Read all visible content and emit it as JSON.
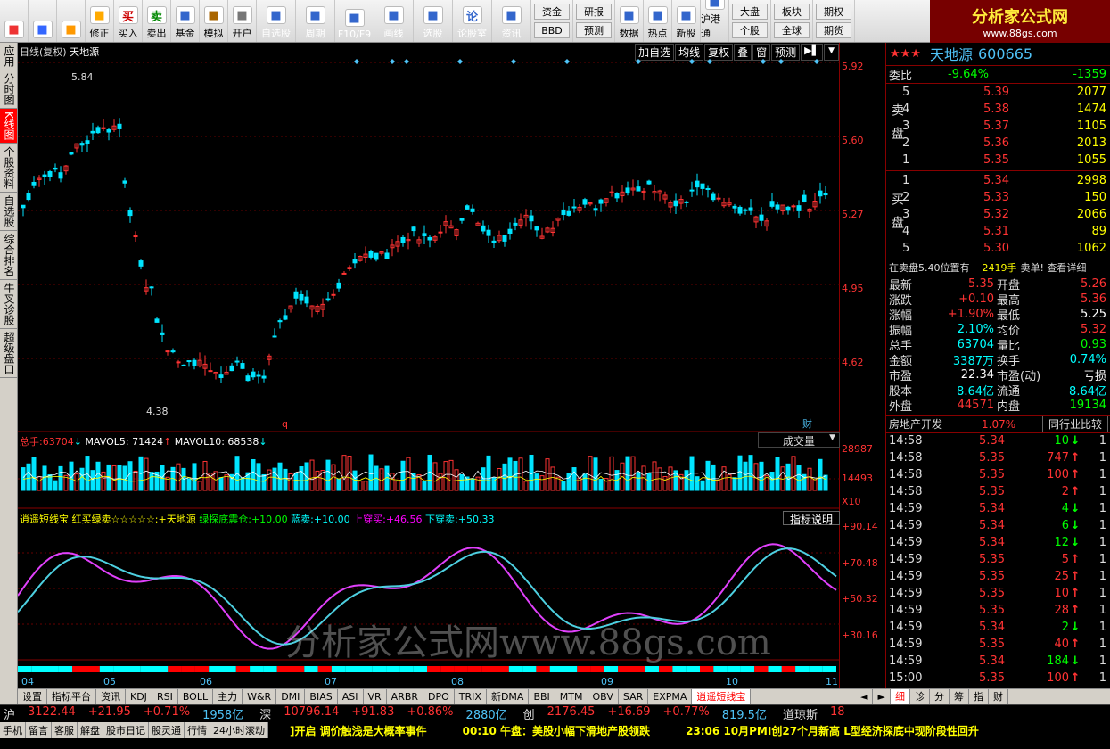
{
  "toolbar": {
    "buttons": [
      {
        "icon": "grid-icon",
        "label": ""
      },
      {
        "icon": "back-arrow-icon",
        "label": ""
      },
      {
        "icon": "up-down-icon",
        "label": ""
      },
      {
        "icon": "modify-icon",
        "label": "修正"
      },
      {
        "icon": "buy-icon",
        "label": "买入",
        "glyph": "买"
      },
      {
        "icon": "sell-icon",
        "label": "卖出",
        "glyph": "卖"
      },
      {
        "icon": "fund-icon",
        "label": "基金"
      },
      {
        "icon": "simulate-icon",
        "label": "模拟"
      },
      {
        "icon": "lock-icon",
        "label": "开户"
      },
      {
        "icon": "watchlist-icon",
        "label": "自选股"
      },
      {
        "icon": "period-icon",
        "label": "周期"
      },
      {
        "icon": "f10-icon",
        "label": "F10/F9"
      },
      {
        "icon": "draw-icon",
        "label": "画线"
      },
      {
        "icon": "select-stock-icon",
        "label": "选股"
      },
      {
        "icon": "forum-icon",
        "label": "论股室",
        "glyph": "论"
      },
      {
        "icon": "news-icon",
        "label": "资讯"
      }
    ],
    "group1": [
      "资金",
      "BBD"
    ],
    "group2": [
      "研报",
      "预测"
    ],
    "buttons2": [
      {
        "icon": "pe-icon",
        "label": "数据"
      },
      {
        "icon": "hot-icon",
        "label": "热点"
      },
      {
        "icon": "ipo-icon",
        "label": "新股"
      },
      {
        "icon": "hk-connect-icon",
        "label": "沪港通"
      }
    ],
    "group3": [
      "大盘",
      "个股"
    ],
    "group4": [
      "板块",
      "全球"
    ],
    "group5": [
      "期权",
      "期货"
    ]
  },
  "logo": {
    "title": "分析家公式网",
    "url": "www.88gs.com"
  },
  "left_tabs": [
    {
      "label": "应用",
      "active": false
    },
    {
      "label": "分时图",
      "active": false
    },
    {
      "label": "K线图",
      "active": true
    },
    {
      "label": "个股资料",
      "active": false
    },
    {
      "label": "自选股",
      "active": false
    },
    {
      "label": "综合排名",
      "active": false
    },
    {
      "label": "牛叉诊股",
      "active": false
    },
    {
      "label": "超级盘口",
      "active": false
    }
  ],
  "chart_header": {
    "period": "日线(复权)",
    "name": "天地源"
  },
  "chart_buttons": [
    "加自选",
    "均线",
    "复权",
    "叠",
    "窗",
    "预测"
  ],
  "price_axis": [
    "5.92",
    "5.60",
    "5.27",
    "4.95",
    "4.62"
  ],
  "annotations": {
    "high": "5.84",
    "low": "4.38",
    "q_mark": "q",
    "cai_mark": "财"
  },
  "volume_legend": {
    "label": "总手:",
    "value": "63704",
    "arrow1": "↓",
    "ma5": "MAVOL5: 71424",
    "arrow2": "↑",
    "ma10": "MAVOL10: 68538",
    "arrow3": "↓"
  },
  "volume_axis": [
    "28987",
    "14493",
    "X10"
  ],
  "volume_select": "成交量",
  "indicator_legend": {
    "name": "逍遥短线宝",
    "text1": "红买绿卖☆☆☆☆☆:",
    "text2": "+天地源",
    "t3": "绿探底震仓:",
    "v3": "+10.00",
    "t4": "蓝卖:",
    "v4": "+10.00",
    "t5": "上穿买:",
    "v5": "+46.56",
    "t6": "下穿卖:",
    "v6": "+50.33"
  },
  "indicator_button": "指标说明",
  "indicator_axis": [
    "+90.14",
    "+70.48",
    "+50.32",
    "+30.16"
  ],
  "x_axis": [
    "04",
    "05",
    "06",
    "07",
    "08",
    "09",
    "10",
    "11"
  ],
  "watermark": "分析家公式网www.88gs.com",
  "quote": {
    "stars": "★★★",
    "name": "天地源",
    "code": "600665",
    "weibi_label": "委比",
    "weibi_pct": "-9.64%",
    "weibi_val": "-1359",
    "sell_label": "卖盘",
    "buy_label": "买盘",
    "sell": [
      {
        "lvl": "5",
        "price": "5.39",
        "vol": "2077"
      },
      {
        "lvl": "4",
        "price": "5.38",
        "vol": "1474"
      },
      {
        "lvl": "3",
        "price": "5.37",
        "vol": "1105"
      },
      {
        "lvl": "2",
        "price": "5.36",
        "vol": "2013"
      },
      {
        "lvl": "1",
        "price": "5.35",
        "vol": "1055"
      }
    ],
    "buy": [
      {
        "lvl": "1",
        "price": "5.34",
        "vol": "2998"
      },
      {
        "lvl": "2",
        "price": "5.33",
        "vol": "150"
      },
      {
        "lvl": "3",
        "price": "5.32",
        "vol": "2066"
      },
      {
        "lvl": "4",
        "price": "5.31",
        "vol": "89"
      },
      {
        "lvl": "5",
        "price": "5.30",
        "vol": "1062"
      }
    ],
    "bigorder": {
      "text": "在卖盘5.40位置有",
      "vol": "2419手",
      "tail": "卖单! 查看详细"
    },
    "stats": [
      [
        "最新",
        "5.35",
        "r",
        "开盘",
        "5.26",
        "r"
      ],
      [
        "涨跌",
        "+0.10",
        "r",
        "最高",
        "5.36",
        "r"
      ],
      [
        "涨幅",
        "+1.90%",
        "r",
        "最低",
        "5.25",
        "w"
      ],
      [
        "振幅",
        "2.10%",
        "c",
        "均价",
        "5.32",
        "r"
      ],
      [
        "总手",
        "63704",
        "c",
        "量比",
        "0.93",
        "g"
      ],
      [
        "金额",
        "3387万",
        "c",
        "换手",
        "0.74%",
        "c"
      ],
      [
        "市盈",
        "22.34",
        "w",
        "市盈(动)",
        "亏损",
        "w"
      ],
      [
        "股本",
        "8.64亿",
        "c",
        "流通",
        "8.64亿",
        "c"
      ],
      [
        "外盘",
        "44571",
        "r",
        "内盘",
        "19134",
        "g"
      ]
    ],
    "sector": {
      "name": "房地产开发",
      "pct": "1.07%",
      "btn": "同行业比较"
    },
    "ticks": [
      [
        "14:58",
        "5.34",
        "10",
        "↓",
        "g",
        "1"
      ],
      [
        "14:58",
        "5.35",
        "747",
        "↑",
        "r",
        "1"
      ],
      [
        "14:58",
        "5.35",
        "100",
        "↑",
        "r",
        "1"
      ],
      [
        "14:58",
        "5.35",
        "2",
        "↑",
        "r",
        "1"
      ],
      [
        "14:59",
        "5.34",
        "4",
        "↓",
        "g",
        "1"
      ],
      [
        "14:59",
        "5.34",
        "6",
        "↓",
        "g",
        "1"
      ],
      [
        "14:59",
        "5.34",
        "12",
        "↓",
        "g",
        "1"
      ],
      [
        "14:59",
        "5.35",
        "5",
        "↑",
        "r",
        "1"
      ],
      [
        "14:59",
        "5.35",
        "25",
        "↑",
        "r",
        "1"
      ],
      [
        "14:59",
        "5.35",
        "10",
        "↑",
        "r",
        "1"
      ],
      [
        "14:59",
        "5.35",
        "28",
        "↑",
        "r",
        "1"
      ],
      [
        "14:59",
        "5.34",
        "2",
        "↓",
        "g",
        "1"
      ],
      [
        "14:59",
        "5.35",
        "40",
        "↑",
        "r",
        "1"
      ],
      [
        "14:59",
        "5.34",
        "184",
        "↓",
        "g",
        "1"
      ],
      [
        "15:00",
        "5.35",
        "100",
        "↑",
        "r",
        "1"
      ]
    ]
  },
  "bottom_tabs": [
    "设置",
    "指标平台",
    "资讯",
    "KDJ",
    "RSI",
    "BOLL",
    "主力",
    "W&R",
    "DMI",
    "BIAS",
    "ASI",
    "VR",
    "ARBR",
    "DPO",
    "TRIX",
    "新DMA",
    "BBI",
    "MTM",
    "OBV",
    "SAR",
    "EXPMA",
    "逍遥短线宝"
  ],
  "right_tabs": [
    "细",
    "诊",
    "分",
    "筹",
    "指",
    "财"
  ],
  "indexes": [
    {
      "name": "沪",
      "val": "3122.44",
      "chg": "+21.95",
      "pct": "+0.71%",
      "amt": "1958亿"
    },
    {
      "name": "深",
      "val": "10796.14",
      "chg": "+91.83",
      "pct": "+0.86%",
      "amt": "2880亿"
    },
    {
      "name": "创",
      "val": "2176.45",
      "chg": "+16.69",
      "pct": "+0.77%",
      "amt": "819.5亿"
    },
    {
      "name": "道琼斯",
      "val": "18",
      "chg": "",
      "pct": "",
      "amt": ""
    }
  ],
  "status_tabs": [
    "手机",
    "留言",
    "客服",
    "解盘",
    "股市日记",
    "股灵通",
    "行情",
    "24小时滚动"
  ],
  "news": [
    "]开启 调价触浅是大概率事件",
    "00:10 午盘：美股小幅下滑地产股领跌",
    "23:06 10月PMI创27个月新高 L型经济探底中现阶段性回升"
  ],
  "colors": {
    "up": "#ff3333",
    "down": "#00e5ff",
    "grid": "#800000",
    "ma5": "#ffffff",
    "ma10": "#ffff00"
  }
}
